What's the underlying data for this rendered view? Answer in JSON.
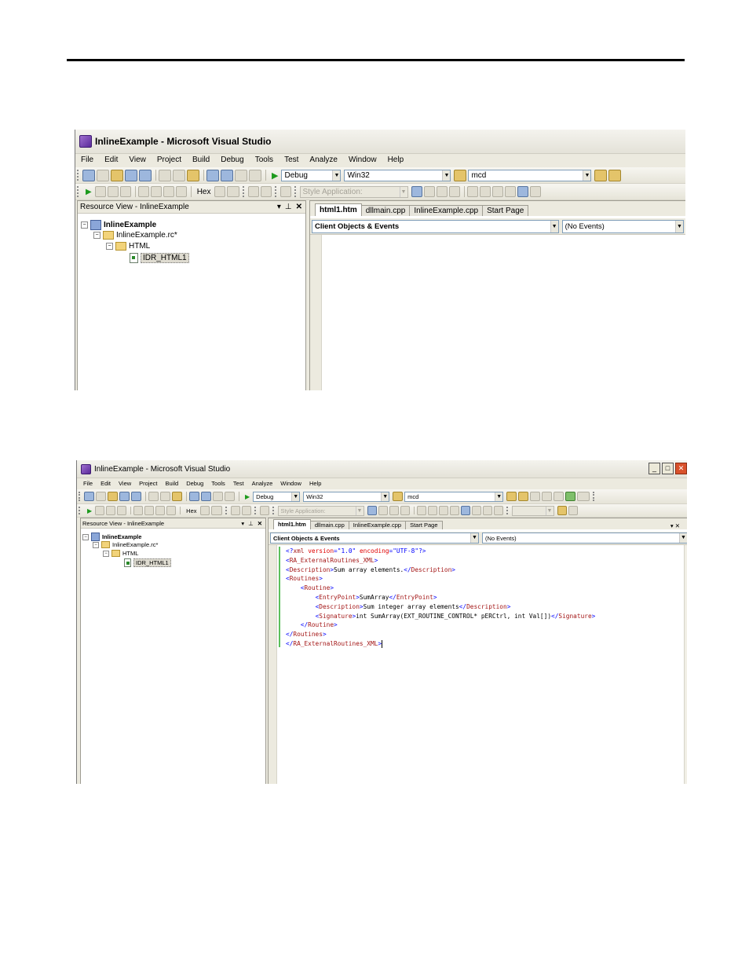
{
  "screenshots": [
    {
      "window_title": "InlineExample - Microsoft Visual Studio",
      "menu": [
        "File",
        "Edit",
        "View",
        "Project",
        "Build",
        "Debug",
        "Tools",
        "Test",
        "Analyze",
        "Window",
        "Help"
      ],
      "toolbar": {
        "config": "Debug",
        "platform": "Win32",
        "find": "mcd",
        "hex_label": "Hex",
        "style_label": "Style Application:"
      },
      "resource_view": {
        "title": "Resource View - InlineExample",
        "tree": [
          "InlineExample",
          "InlineExample.rc*",
          "HTML",
          "IDR_HTML1"
        ]
      },
      "tabs": [
        "html1.htm",
        "dllmain.cpp",
        "InlineExample.cpp",
        "Start Page"
      ],
      "objects_dropdown": "Client Objects & Events",
      "events_dropdown": "(No Events)",
      "code_lines": []
    },
    {
      "window_title": "InlineExample - Microsoft Visual Studio",
      "menu": [
        "File",
        "Edit",
        "View",
        "Project",
        "Build",
        "Debug",
        "Tools",
        "Test",
        "Analyze",
        "Window",
        "Help"
      ],
      "toolbar": {
        "config": "Debug",
        "platform": "Win32",
        "find": "mcd",
        "hex_label": "Hex",
        "style_label": "Style Application:"
      },
      "resource_view": {
        "title": "Resource View - InlineExample",
        "tree": [
          "InlineExample",
          "InlineExample.rc*",
          "HTML",
          "IDR_HTML1"
        ]
      },
      "tabs": [
        "html1.htm",
        "dllmain.cpp",
        "InlineExample.cpp",
        "Start Page"
      ],
      "objects_dropdown": "Client Objects & Events",
      "events_dropdown": "(No Events)",
      "code_lines": [
        "<?xml version=\"1.0\" encoding=\"UTF-8\"?>",
        "<RA_ExternalRoutines_XML>",
        "<Description>Sum array elements.</Description>",
        "<Routines>",
        "    <Routine>",
        "        <EntryPoint>SumArray</EntryPoint>",
        "        <Description>Sum integer array elements</Description>",
        "        <Signature>int SumArray(EXT_ROUTINE_CONTROL* pERCtrl, int Val[])</Signature>",
        "    </Routine>",
        "</Routines>",
        "</RA_ExternalRoutines_XML>"
      ]
    }
  ]
}
